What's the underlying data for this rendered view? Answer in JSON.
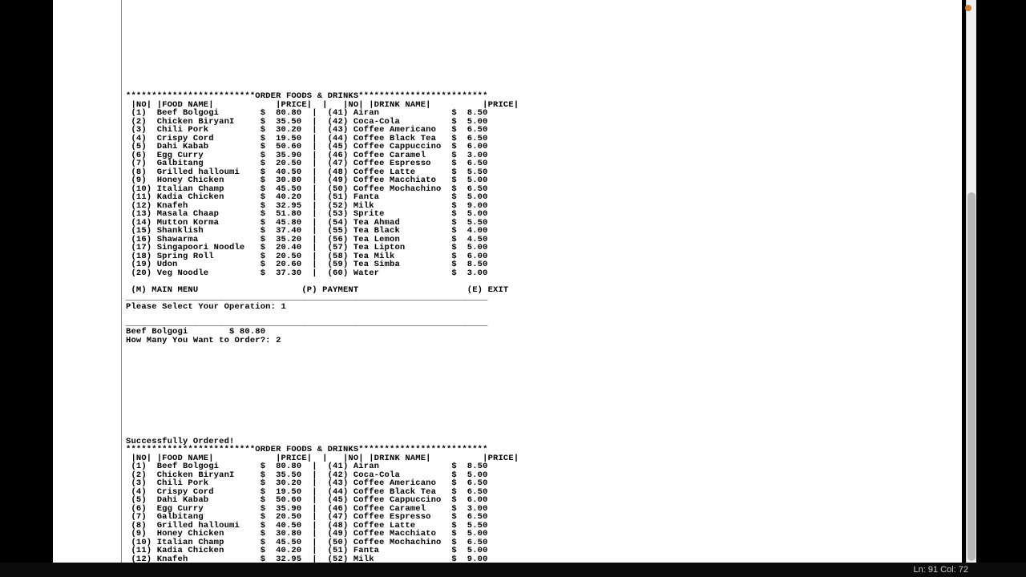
{
  "menu_title": "ORDER FOODS & DRINKS",
  "headers": {
    "no": "|NO|",
    "food": "|FOOD NAME|",
    "price": "|PRICE|",
    "drink": "|DRINK NAME|"
  },
  "foods": [
    {
      "no": 1,
      "name": "Beef Bolgogi",
      "price": 80.8
    },
    {
      "no": 2,
      "name": "Chicken BiryanI",
      "price": 35.5
    },
    {
      "no": 3,
      "name": "Chili Pork",
      "price": 30.2
    },
    {
      "no": 4,
      "name": "Crispy Cord",
      "price": 19.5
    },
    {
      "no": 5,
      "name": "Dahi Kabab",
      "price": 50.6
    },
    {
      "no": 6,
      "name": "Egg Curry",
      "price": 35.9
    },
    {
      "no": 7,
      "name": "Galbitang",
      "price": 20.5
    },
    {
      "no": 8,
      "name": "Grilled halloumi",
      "price": 40.5
    },
    {
      "no": 9,
      "name": "Honey Chicken",
      "price": 30.8
    },
    {
      "no": 10,
      "name": "Italian Champ",
      "price": 45.5
    },
    {
      "no": 11,
      "name": "Kadia Chicken",
      "price": 40.2
    },
    {
      "no": 12,
      "name": "Knafeh",
      "price": 32.95
    },
    {
      "no": 13,
      "name": "Masala Chaap",
      "price": 51.8
    },
    {
      "no": 14,
      "name": "Mutton Korma",
      "price": 45.8
    },
    {
      "no": 15,
      "name": "Shanklish",
      "price": 37.4
    },
    {
      "no": 16,
      "name": "Shawarma",
      "price": 35.2
    },
    {
      "no": 17,
      "name": "Singapoori Noodle",
      "price": 20.4
    },
    {
      "no": 18,
      "name": "Spring Roll",
      "price": 20.5
    },
    {
      "no": 19,
      "name": "Udon",
      "price": 20.6
    },
    {
      "no": 20,
      "name": "Veg Noodle",
      "price": 37.3
    }
  ],
  "drinks": [
    {
      "no": 41,
      "name": "Airan",
      "price": 8.5
    },
    {
      "no": 42,
      "name": "Coca-Cola",
      "price": 5.0
    },
    {
      "no": 43,
      "name": "Coffee Americano",
      "price": 6.5
    },
    {
      "no": 44,
      "name": "Coffee Black Tea",
      "price": 6.5
    },
    {
      "no": 45,
      "name": "Coffee Cappuccino",
      "price": 6.0
    },
    {
      "no": 46,
      "name": "Coffee Caramel",
      "price": 3.0
    },
    {
      "no": 47,
      "name": "Coffee Espresso",
      "price": 6.5
    },
    {
      "no": 48,
      "name": "Coffee Latte",
      "price": 5.5
    },
    {
      "no": 49,
      "name": "Coffee Macchiato",
      "price": 5.0
    },
    {
      "no": 50,
      "name": "Coffee Mochachino",
      "price": 6.5
    },
    {
      "no": 51,
      "name": "Fanta",
      "price": 5.0
    },
    {
      "no": 52,
      "name": "Milk",
      "price": 9.0
    },
    {
      "no": 53,
      "name": "Sprite",
      "price": 5.0
    },
    {
      "no": 54,
      "name": "Tea Ahmad",
      "price": 5.5
    },
    {
      "no": 55,
      "name": "Tea Black",
      "price": 4.0
    },
    {
      "no": 56,
      "name": "Tea Lemon",
      "price": 4.5
    },
    {
      "no": 57,
      "name": "Tea Lipton",
      "price": 5.0
    },
    {
      "no": 58,
      "name": "Tea Milk",
      "price": 6.0
    },
    {
      "no": 59,
      "name": "Tea Simba",
      "price": 8.5
    },
    {
      "no": 60,
      "name": "Water",
      "price": 3.0
    }
  ],
  "menu_options": {
    "main": "(M) MAIN MENU",
    "payment": "(P) PAYMENT",
    "exit": "(E) EXIT"
  },
  "prompt_select": "Please Select Your Operation: ",
  "selection_value": "1",
  "selected_item": {
    "name": "Beef Bolgogi",
    "price": 80.8
  },
  "prompt_qty": "How Many You Want to Order?: ",
  "qty_value": "2",
  "success_msg": "Successfully Ordered!",
  "second_menu_rows": 13,
  "statusbar": "Ln: 91   Col: 72"
}
